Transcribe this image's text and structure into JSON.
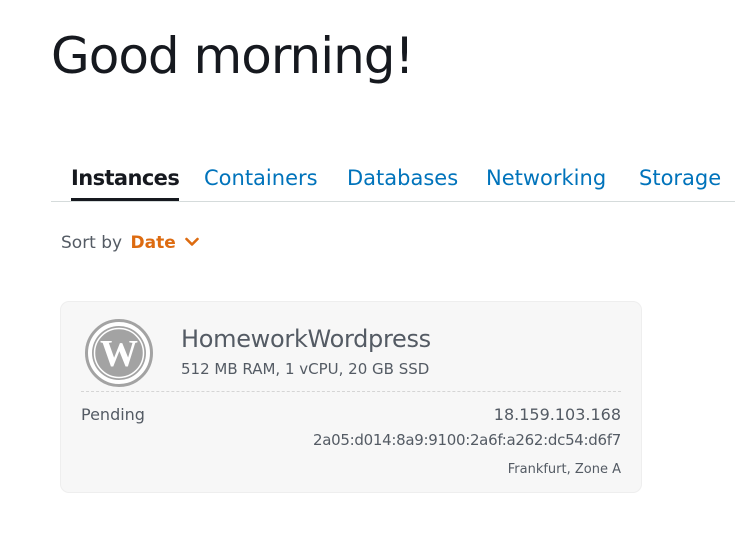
{
  "header": {
    "greeting": "Good morning!"
  },
  "tabs": [
    {
      "label": "Instances",
      "active": true
    },
    {
      "label": "Containers",
      "active": false
    },
    {
      "label": "Databases",
      "active": false
    },
    {
      "label": "Networking",
      "active": false
    },
    {
      "label": "Storage",
      "active": false
    }
  ],
  "sort": {
    "label": "Sort by",
    "value": "Date",
    "icon": "chevron-down-icon"
  },
  "instances": [
    {
      "icon": "wordpress-logo-icon",
      "name": "HomeworkWordpress",
      "specs": "512 MB RAM, 1 vCPU, 20 GB SSD",
      "status": "Pending",
      "public_ipv4": "18.159.103.168",
      "public_ipv6": "2a05:d014:8a9:9100:2a6f:a262:dc54:d6f7",
      "location": "Frankfurt, Zone A"
    }
  ],
  "colors": {
    "link": "#0073bb",
    "accent": "#dd6b10",
    "text": "#16191f",
    "muted": "#545b64",
    "card_background": "#f7f7f7",
    "logo_gray": "#a3a3a3"
  }
}
